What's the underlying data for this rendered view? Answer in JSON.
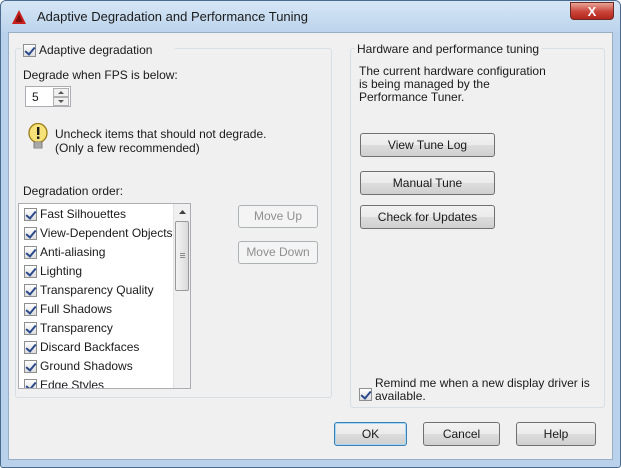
{
  "window": {
    "title": "Adaptive Degradation and Performance Tuning",
    "close_label": "X"
  },
  "adaptive": {
    "checkbox_label": "Adaptive degradation",
    "fps_label": "Degrade when FPS is below:",
    "fps_value": "5",
    "tip_line1": "Uncheck items that should not degrade.",
    "tip_line2": "(Only a few recommended)",
    "order_label": "Degradation order:",
    "items": [
      {
        "label": "Fast Silhouettes",
        "checked": true
      },
      {
        "label": "View-Dependent Objects",
        "checked": true
      },
      {
        "label": "Anti-aliasing",
        "checked": true
      },
      {
        "label": "Lighting",
        "checked": true
      },
      {
        "label": "Transparency Quality",
        "checked": true
      },
      {
        "label": "Full Shadows",
        "checked": true
      },
      {
        "label": "Transparency",
        "checked": true
      },
      {
        "label": "Discard Backfaces",
        "checked": true
      },
      {
        "label": "Ground Shadows",
        "checked": true
      },
      {
        "label": "Edge Styles",
        "checked": true
      }
    ],
    "move_up": "Move Up",
    "move_down": "Move Down"
  },
  "hardware": {
    "title": "Hardware and performance tuning",
    "desc1": "The current hardware configuration",
    "desc2": "is being managed by the",
    "desc3": "Performance Tuner.",
    "view_log": "View Tune Log",
    "manual_tune": "Manual Tune",
    "check_updates": "Check for Updates",
    "remind1": "Remind me when a new display driver is",
    "remind2": "available."
  },
  "footer": {
    "ok": "OK",
    "cancel": "Cancel",
    "help": "Help"
  }
}
